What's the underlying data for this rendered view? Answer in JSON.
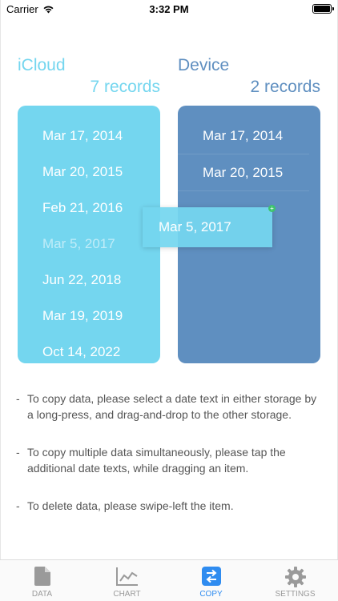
{
  "status_bar": {
    "carrier": "Carrier",
    "time": "3:32 PM"
  },
  "icloud": {
    "title": "iCloud",
    "count": "7 records",
    "color": "#74d6ef",
    "dates": [
      "Mar 17, 2014",
      "Mar 20, 2015",
      "Feb 21, 2016",
      "Mar 5, 2017",
      "Jun 22, 2018",
      "Mar 19, 2019",
      "Oct 14, 2022"
    ]
  },
  "device": {
    "title": "Device",
    "count": "2 records",
    "color": "#5f8fc0",
    "dates": [
      "Mar 17, 2014",
      "Mar 20, 2015"
    ]
  },
  "dragging_item": {
    "label": "Mar 5, 2017"
  },
  "instructions": [
    "To copy data, please select a date text in either storage by a long-press, and drag-and-drop to the other storage.",
    "To copy multiple data simultaneously, please tap the additional date texts, while dragging an item.",
    "To delete data, please swipe-left the item."
  ],
  "tabbar": {
    "active_color": "#2f8cf0",
    "tabs": [
      {
        "label": "DATA",
        "icon": "document-icon",
        "active": false
      },
      {
        "label": "CHART",
        "icon": "chart-icon",
        "active": false
      },
      {
        "label": "COPY",
        "icon": "swap-arrows-icon",
        "active": true
      },
      {
        "label": "SETTINGS",
        "icon": "gear-icon",
        "active": false
      }
    ]
  }
}
